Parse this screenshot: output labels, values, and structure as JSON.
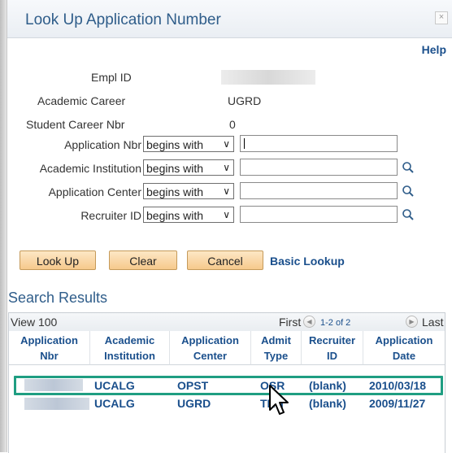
{
  "dialog": {
    "title": "Look Up Application Number",
    "close_glyph": "×",
    "help": "Help"
  },
  "fields": {
    "empl_id_label": "Empl ID",
    "career_label": "Academic Career",
    "career_value": "UGRD",
    "career_nbr_label": "Student Career Nbr",
    "career_nbr_value": "0",
    "criteria": [
      {
        "label": "Application Nbr",
        "operator": "begins with",
        "value": ""
      },
      {
        "label": "Academic Institution",
        "operator": "begins with",
        "value": ""
      },
      {
        "label": "Application Center",
        "operator": "begins with",
        "value": ""
      },
      {
        "label": "Recruiter ID",
        "operator": "begins with",
        "value": ""
      }
    ]
  },
  "buttons": {
    "lookup": "Look Up",
    "clear": "Clear",
    "cancel": "Cancel",
    "basic_lookup": "Basic Lookup"
  },
  "results": {
    "title": "Search Results",
    "view": "View 100",
    "first": "First",
    "count": "1-2 of 2",
    "last": "Last",
    "columns": [
      {
        "line1": "Application",
        "line2": "Nbr"
      },
      {
        "line1": "Academic",
        "line2": "Institution"
      },
      {
        "line1": "Application",
        "line2": "Center"
      },
      {
        "line1": "Admit",
        "line2": "Type"
      },
      {
        "line1": "Recruiter",
        "line2": "ID"
      },
      {
        "line1": "Application",
        "line2": "Date"
      }
    ],
    "rows": [
      {
        "institution": "UCALG",
        "center": "OPST",
        "admit_type": "OSR",
        "recruiter": "(blank)",
        "date": "2010/03/18"
      },
      {
        "institution": "UCALG",
        "center": "UGRD",
        "admit_type": "TRN",
        "recruiter": "(blank)",
        "date": "2009/11/27"
      }
    ]
  },
  "icons": {
    "lookup": "magnifier-icon",
    "prev": "prev-arrow-icon",
    "next": "next-arrow-icon",
    "cursor": "mouse-pointer-icon"
  },
  "colors": {
    "link": "#1a4f8c",
    "highlight": "#1f9e82",
    "button": "#f6c98c"
  }
}
